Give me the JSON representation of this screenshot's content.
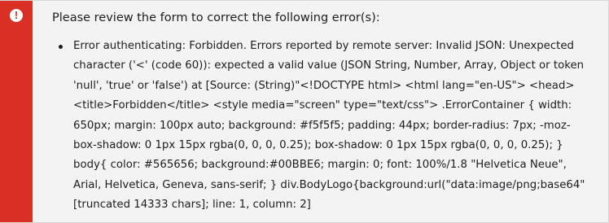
{
  "colors": {
    "stripe": "#d93025",
    "icon_glyph": "#d93025",
    "background": "#f3f3f3",
    "text": "#1d1d21"
  },
  "alert": {
    "icon": "exclamation-icon",
    "icon_glyph": "!",
    "title": "Please review the form to correct the following error(s):",
    "errors": [
      "Error authenticating: Forbidden. Errors reported by remote server: Invalid JSON: Unexpected character ('<' (code 60)): expected a valid value (JSON String, Number, Array, Object or token 'null', 'true' or 'false') at [Source: (String)\"<!DOCTYPE html> <html lang=\"en-US\"> <head> <title>Forbidden</title> <style media=\"screen\" type=\"text/css\"> .ErrorContainer { width: 650px; margin: 100px auto; background: #f5f5f5; padding: 44px; border-radius: 7px; -moz-box-shadow: 0 1px 15px rgba(0, 0, 0, 0.25); box-shadow: 0 1px 15px rgba(0, 0, 0, 0.25); } body{ color: #565656; background:#00BBE6; margin: 0; font: 100%/1.8 \"Helvetica Neue\", Arial, Helvetica, Geneva, sans-serif; } div.BodyLogo{background:url(\"data:image/png;base64\"[truncated 14333 chars]; line: 1, column: 2]"
    ]
  }
}
